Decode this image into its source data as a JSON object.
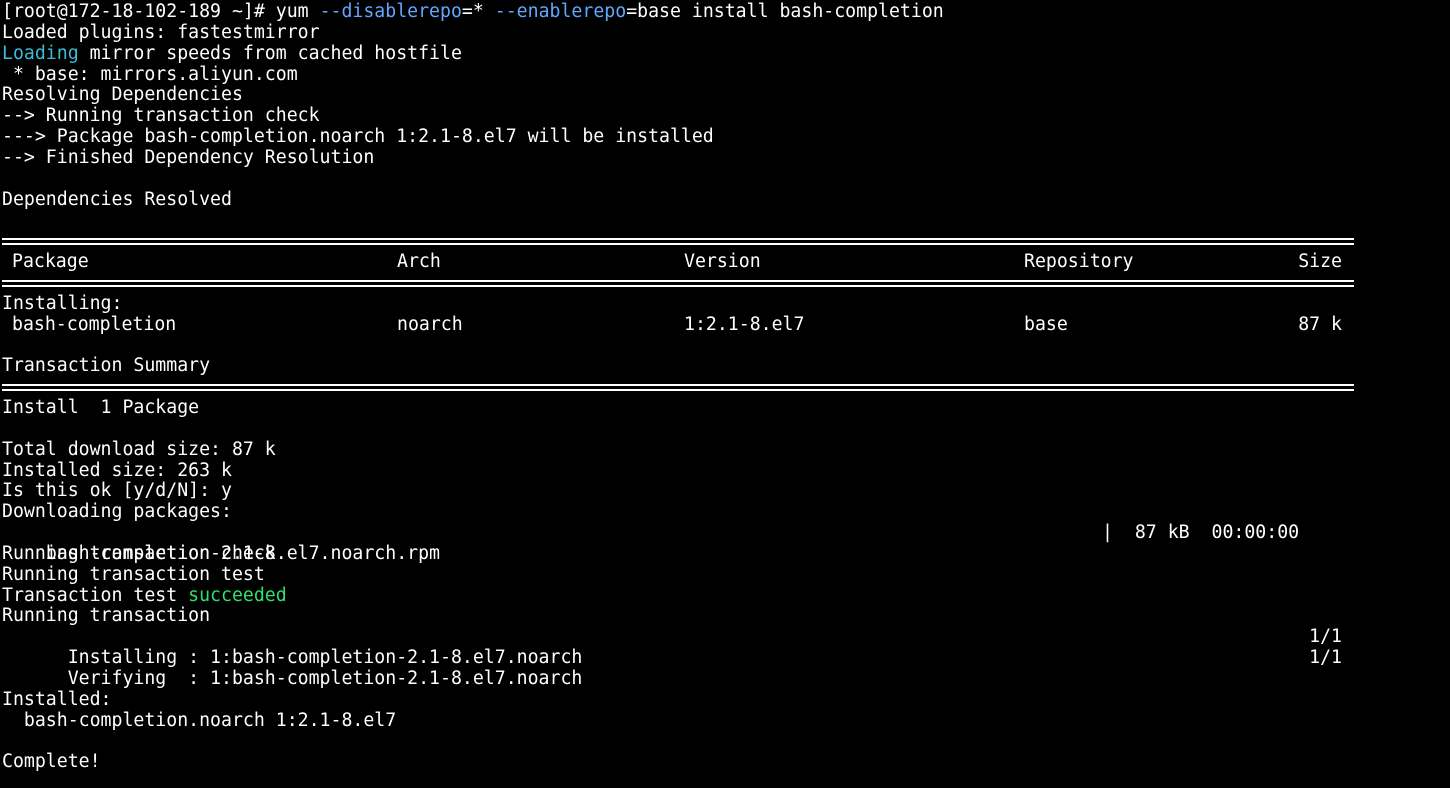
{
  "terminal": {
    "prompt": "[root@172-18-102-189 ~]# ",
    "command": {
      "cmd": "yum ",
      "flag1": "--disablerepo",
      "eq1": "=* ",
      "flag2": "--enablerepo",
      "rest": "=base install bash-completion"
    },
    "loaded_plugins": "Loaded plugins: fastestmirror",
    "loading_word": "Loading",
    "loading_rest": " mirror speeds from cached hostfile",
    "base_mirror": " * base: mirrors.aliyun.com",
    "resolving": "Resolving Dependencies",
    "running_check": "--> Running transaction check",
    "package_will_install": "---> Package bash-completion.noarch 1:2.1-8.el7 will be installed",
    "finished_resolution": "--> Finished Dependency Resolution",
    "deps_resolved": "Dependencies Resolved",
    "table": {
      "headers": {
        "package": "Package",
        "arch": "Arch",
        "version": "Version",
        "repository": "Repository",
        "size": "Size"
      },
      "installing_label": "Installing:",
      "rows": [
        {
          "package": "bash-completion",
          "arch": "noarch",
          "version": "1:2.1-8.el7",
          "repository": "base",
          "size": "87 k"
        }
      ]
    },
    "transaction_summary": "Transaction Summary",
    "install_count": "Install  1 Package",
    "total_download": "Total download size: 87 k",
    "installed_size": "Installed size: 263 k",
    "confirm_prompt": "Is this ok [y/d/N]: y",
    "downloading": "Downloading packages:",
    "download_file": "bash-completion-2.1-8.el7.noarch.rpm",
    "download_stats": "|  87 kB  00:00:00",
    "running_tx_check": "Running transaction check",
    "running_tx_test": "Running transaction test",
    "tx_test_prefix": "Transaction test ",
    "tx_test_result": "succeeded",
    "running_tx": "Running transaction",
    "installing_step": "  Installing : 1:bash-completion-2.1-8.el7.noarch",
    "installing_progress": "1/1",
    "verifying_step": "  Verifying  : 1:bash-completion-2.1-8.el7.noarch",
    "verifying_progress": "1/1",
    "installed_label": "Installed:",
    "installed_pkg": "  bash-completion.noarch 1:2.1-8.el7",
    "complete": "Complete!"
  },
  "colors": {
    "background": "#000000",
    "foreground": "#ffffff",
    "flag": "#5fa8ff",
    "loading": "#3bbcd8",
    "success": "#2fe06a"
  }
}
